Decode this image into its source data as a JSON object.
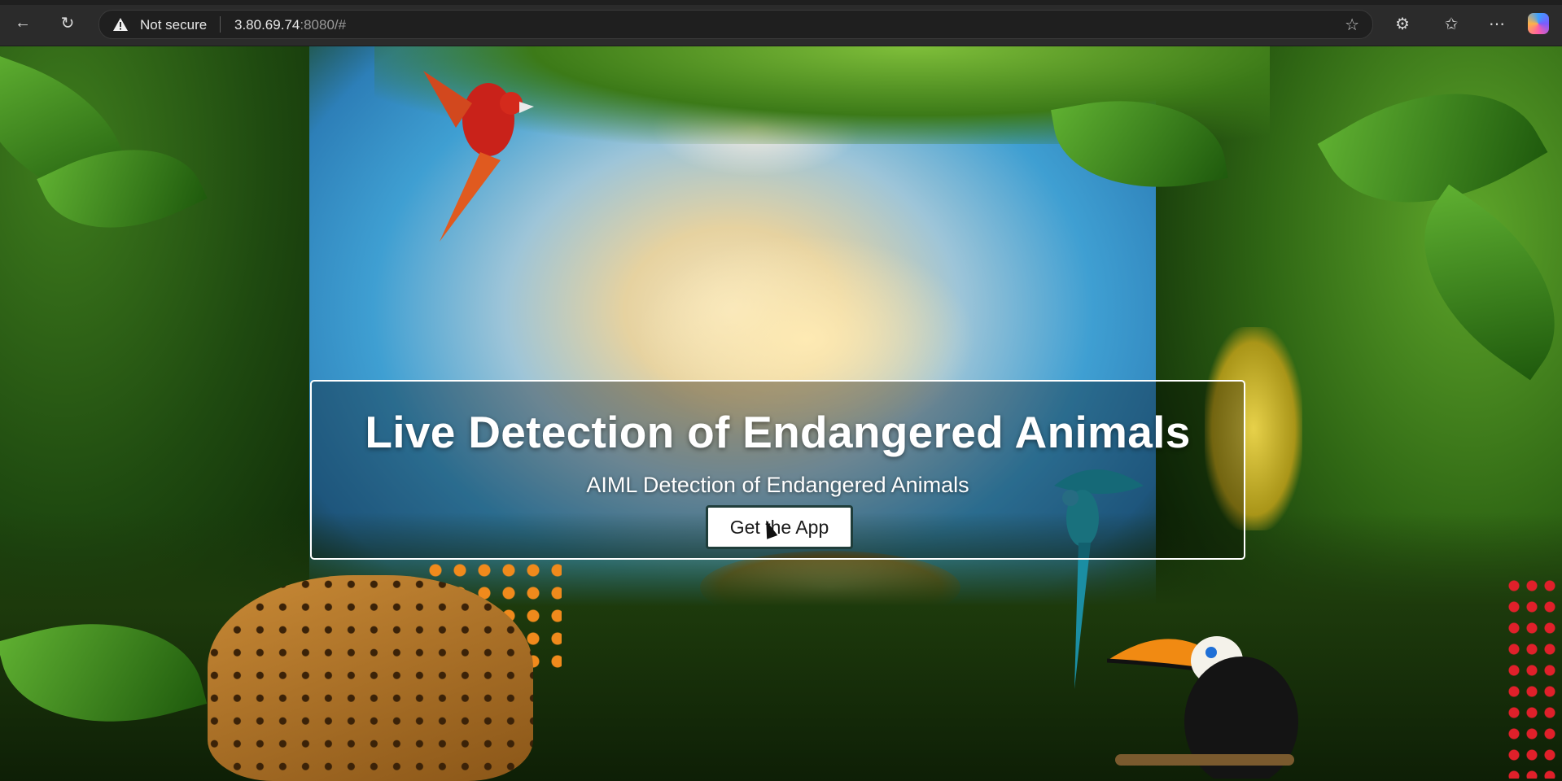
{
  "browser": {
    "security_label": "Not secure",
    "url_host": "3.80.69.74",
    "url_rest": ":8080/#",
    "icons": [
      "back-icon",
      "refresh-icon",
      "warning-icon",
      "favorite-star-icon",
      "extensions-icon",
      "favorites-icon",
      "more-icon",
      "copilot-icon"
    ]
  },
  "hero": {
    "title": "Live Detection of Endangered Animals",
    "subtitle": "AIML Detection of Endangered Animals",
    "button_label": "Get the App"
  },
  "colors": {
    "browser_bar": "#2b2b2b",
    "address_bg": "#1f1f1f",
    "hero_border": "#ffffff",
    "button_border": "#1f3d3a"
  }
}
